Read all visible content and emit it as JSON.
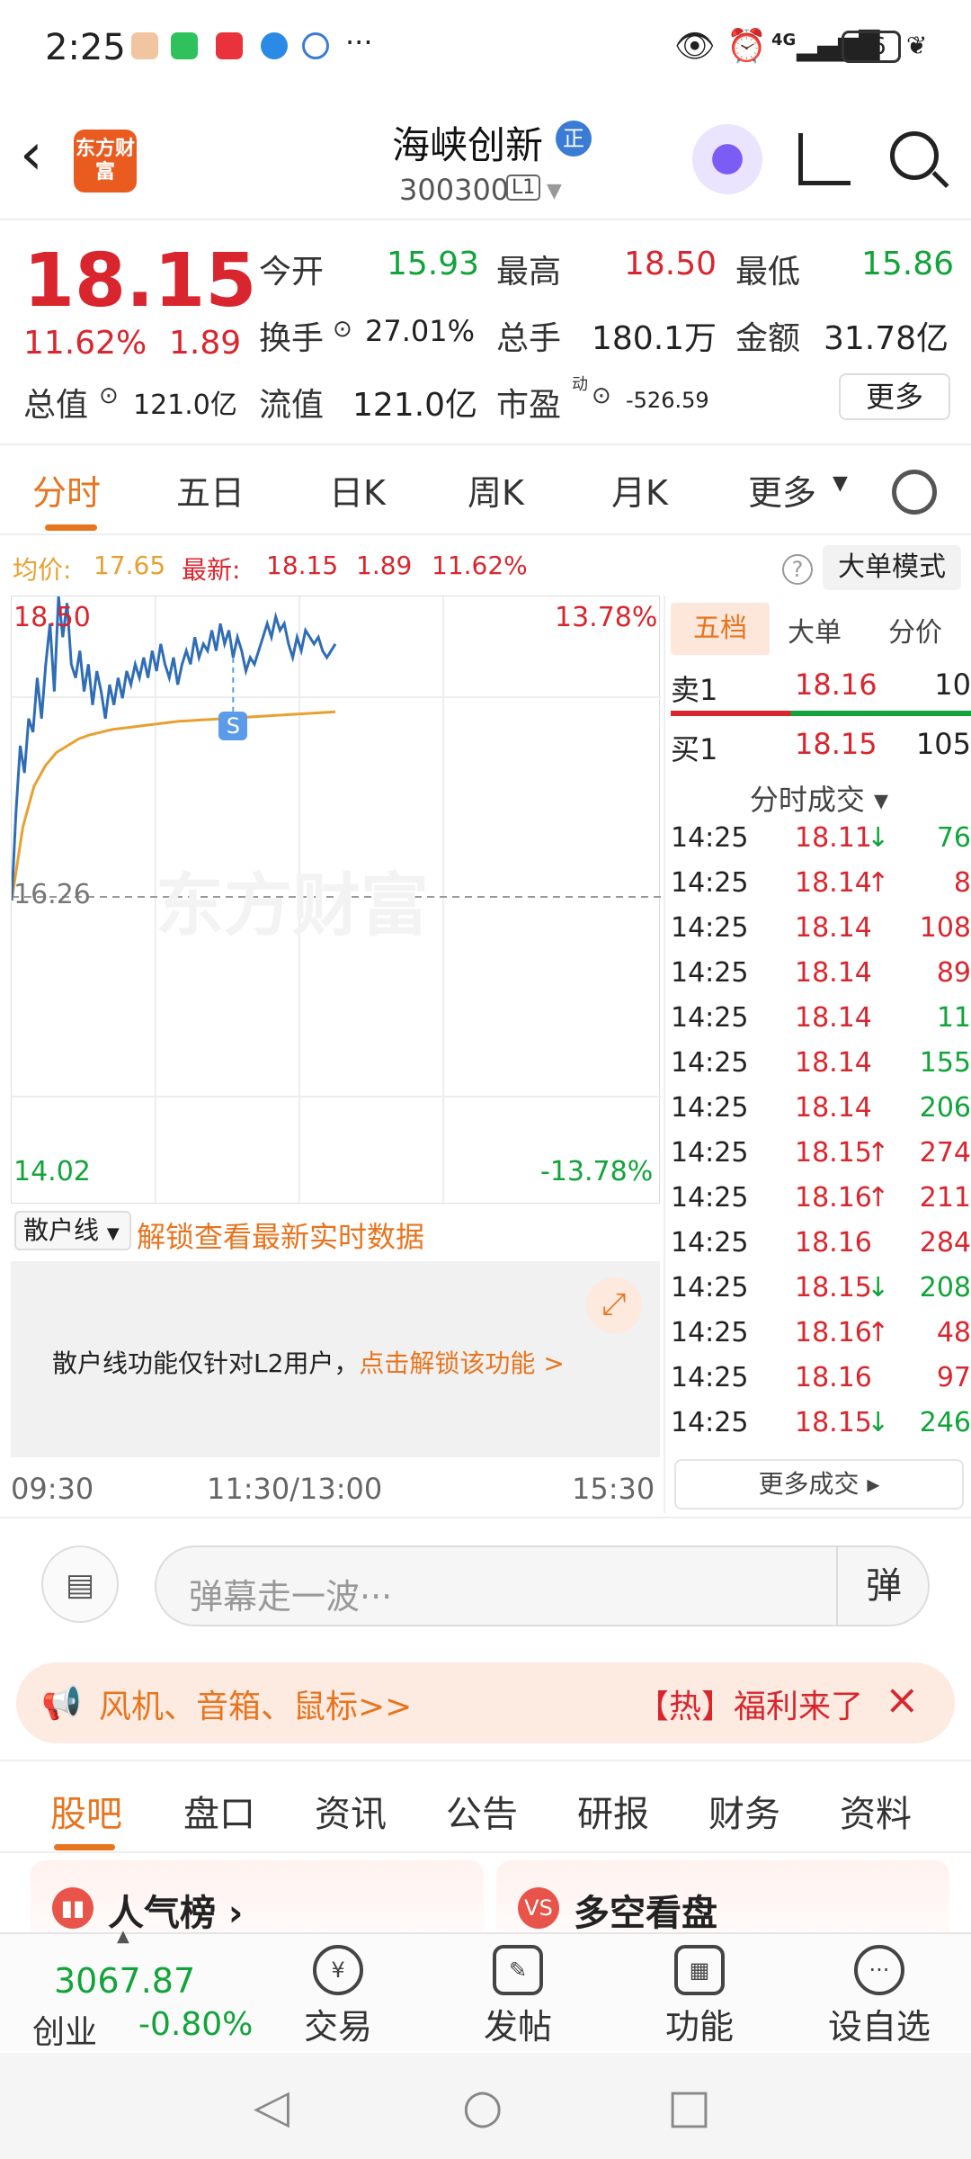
{
  "status": {
    "time": "2:25",
    "battery": "36",
    "network": "4G"
  },
  "header": {
    "logo_text": "东方财富",
    "stock_name": "海峡创新",
    "badge": "正",
    "code": "300300",
    "level": "L1"
  },
  "quote": {
    "price": "18.15",
    "change_pct": "11.62%",
    "change": "1.89",
    "open_label": "今开",
    "open": "15.93",
    "high_label": "最高",
    "high": "18.50",
    "low_label": "最低",
    "low": "15.86",
    "turnover_label": "换手",
    "turnover": "27.01%",
    "volume_label": "总手",
    "volume": "180.1万",
    "amount_label": "金额",
    "amount": "31.78亿",
    "mktcap_label": "总值",
    "mktcap": "121.0亿",
    "float_label": "流值",
    "float": "121.0亿",
    "pe_label": "市盈",
    "pe_sup": "动",
    "pe": "-526.59",
    "more": "更多"
  },
  "tabs": [
    "分时",
    "五日",
    "日K",
    "周K",
    "月K",
    "更多"
  ],
  "avgbar": {
    "avg_label": "均价:",
    "avg": "17.65",
    "latest_label": "最新:",
    "latest": "18.15",
    "chg": "1.89",
    "pct": "11.62%",
    "mode": "大单模式",
    "help": "?"
  },
  "chart_data": {
    "type": "line",
    "y_top": "18.50",
    "y_mid": "16.26",
    "y_bottom": "14.02",
    "pct_top": "13.78%",
    "pct_bottom": "-13.78%",
    "ylim": [
      14.02,
      18.5
    ],
    "x_start": "09:30",
    "x_mid": "11:30/13:00",
    "x_end": "15:30",
    "marker": "S",
    "watermark": "东方财富",
    "series": [
      {
        "values": [
          16.26,
          16.9,
          17.4,
          17.2,
          17.6,
          17.5,
          17.9,
          17.6,
          18.0,
          18.3,
          17.8,
          18.5,
          18.2,
          18.45,
          18.0,
          17.9,
          18.1,
          17.8,
          18.0,
          17.7,
          17.95,
          17.8,
          17.6,
          17.85,
          17.7,
          17.9,
          17.75,
          17.95,
          17.85,
          18.0,
          17.9,
          18.05,
          17.9,
          18.1,
          17.95,
          18.15,
          18.0,
          17.9,
          18.05,
          17.85,
          18.0,
          18.1,
          18.0,
          18.2,
          18.05,
          18.15,
          18.1,
          18.25,
          18.1,
          18.3,
          18.15,
          18.25,
          18.05,
          18.2,
          18.1,
          17.95,
          18.05,
          18.0,
          18.1,
          18.2,
          18.3,
          18.2,
          18.35,
          18.25,
          18.3,
          18.15,
          18.05,
          18.2,
          18.1,
          18.25,
          18.2,
          18.15,
          18.2,
          18.1,
          18.05,
          18.1,
          18.15
        ]
      },
      {
        "values": [
          16.26,
          16.8,
          17.1,
          17.25,
          17.35,
          17.4,
          17.45,
          17.48,
          17.5,
          17.52,
          17.53,
          17.54,
          17.55,
          17.56,
          17.57,
          17.58,
          17.585,
          17.59,
          17.595,
          17.6,
          17.605,
          17.61,
          17.615,
          17.62,
          17.625,
          17.63,
          17.635,
          17.64,
          17.645,
          17.65
        ]
      }
    ]
  },
  "sanhu": {
    "btn": "散户线",
    "msg": "解锁查看最新实时数据",
    "info": "散户线功能仅针对L2用户，",
    "link": "点击解锁该功能 >"
  },
  "right": {
    "tabs": [
      "五档",
      "大单",
      "分价"
    ],
    "sell": {
      "label": "卖1",
      "price": "18.16",
      "vol": "10"
    },
    "buy": {
      "label": "买1",
      "price": "18.15",
      "vol": "105"
    },
    "trade_header": "分时成交 ▾",
    "trades": [
      {
        "t": "14:25",
        "p": "18.11",
        "a": "↓",
        "v": "76",
        "vc": "green",
        "ac": "green"
      },
      {
        "t": "14:25",
        "p": "18.14",
        "a": "↑",
        "v": "8",
        "vc": "red",
        "ac": "red"
      },
      {
        "t": "14:25",
        "p": "18.14",
        "a": "",
        "v": "108",
        "vc": "red",
        "ac": "red"
      },
      {
        "t": "14:25",
        "p": "18.14",
        "a": "",
        "v": "89",
        "vc": "red",
        "ac": "red"
      },
      {
        "t": "14:25",
        "p": "18.14",
        "a": "",
        "v": "11",
        "vc": "green",
        "ac": "green"
      },
      {
        "t": "14:25",
        "p": "18.14",
        "a": "",
        "v": "155",
        "vc": "green",
        "ac": "green"
      },
      {
        "t": "14:25",
        "p": "18.14",
        "a": "",
        "v": "206",
        "vc": "green",
        "ac": "green"
      },
      {
        "t": "14:25",
        "p": "18.15",
        "a": "↑",
        "v": "274",
        "vc": "red",
        "ac": "red"
      },
      {
        "t": "14:25",
        "p": "18.16",
        "a": "↑",
        "v": "211",
        "vc": "red",
        "ac": "red"
      },
      {
        "t": "14:25",
        "p": "18.16",
        "a": "",
        "v": "284",
        "vc": "red",
        "ac": "red"
      },
      {
        "t": "14:25",
        "p": "18.15",
        "a": "↓",
        "v": "208",
        "vc": "green",
        "ac": "green"
      },
      {
        "t": "14:25",
        "p": "18.16",
        "a": "↑",
        "v": "48",
        "vc": "red",
        "ac": "red"
      },
      {
        "t": "14:25",
        "p": "18.16",
        "a": "",
        "v": "97",
        "vc": "red",
        "ac": "red"
      },
      {
        "t": "14:25",
        "p": "18.15",
        "a": "↓",
        "v": "246",
        "vc": "green",
        "ac": "green"
      }
    ],
    "more_trades": "更多成交 ▸"
  },
  "chat": {
    "placeholder": "弹幕走一波···",
    "danmu": "弹"
  },
  "promo": {
    "text": "风机、音箱、鼠标>>",
    "right": "【热】福利来了",
    "close": "×"
  },
  "bottom_tabs": [
    "股吧",
    "盘口",
    "资讯",
    "公告",
    "研报",
    "财务",
    "资料"
  ],
  "cards": [
    {
      "icon": "▮▮",
      "title": "人气榜 ›",
      "color": "#e8544a"
    },
    {
      "icon": "VS",
      "title": "多空看盘",
      "color": "#e8544a"
    }
  ],
  "bottombar": {
    "index": "3067.87",
    "index_name": "创业",
    "index_chg": "-0.80%",
    "items": [
      {
        "label": "交易",
        "icon": "¥"
      },
      {
        "label": "发帖",
        "icon": "✎"
      },
      {
        "label": "功能",
        "icon": "▦"
      },
      {
        "label": "设自选",
        "icon": "···"
      }
    ]
  },
  "nav": {
    "back": "◁",
    "home": "○",
    "recent": "□"
  },
  "colors": {
    "up": "#d9262e",
    "down": "#12a33a",
    "accent": "#e8741e",
    "price_line": "#2f6db5",
    "avg_line": "#e8a030"
  }
}
